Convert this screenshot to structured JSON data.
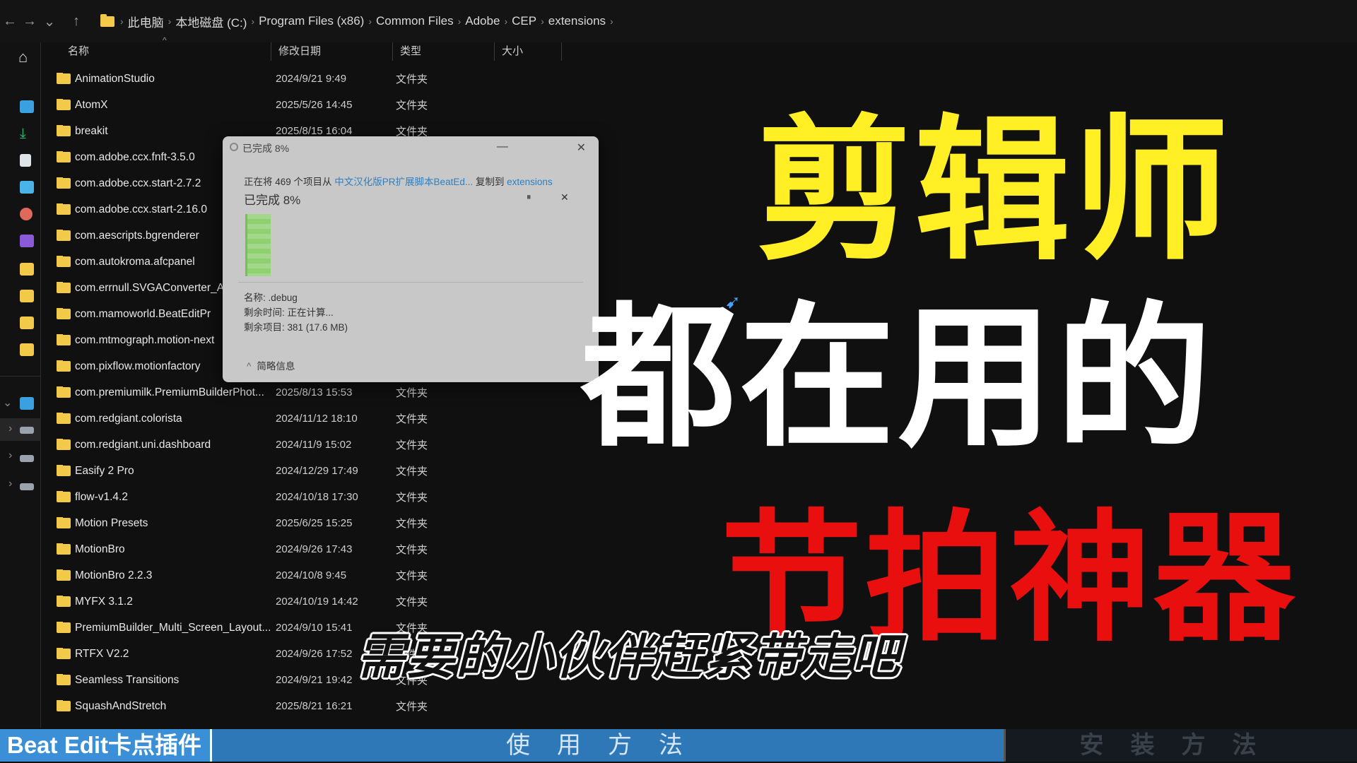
{
  "addressbar": {
    "back": "←",
    "forward": "→",
    "history": "⌄",
    "up": "↑",
    "crumbs": [
      "此电脑",
      "本地磁盘 (C:)",
      "Program Files (x86)",
      "Common Files",
      "Adobe",
      "CEP",
      "extensions"
    ]
  },
  "header": {
    "name": "名称",
    "modified": "修改日期",
    "type": "类型",
    "size": "大小"
  },
  "rows": [
    {
      "name": "AnimationStudio",
      "date": "2024/9/21 9:49",
      "type": "文件夹"
    },
    {
      "name": "AtomX",
      "date": "2025/5/26 14:45",
      "type": "文件夹"
    },
    {
      "name": "breakit",
      "date": "2025/8/15 16:04",
      "type": "文件夹"
    },
    {
      "name": "com.adobe.ccx.fnft-3.5.0",
      "date": "",
      "type": ""
    },
    {
      "name": "com.adobe.ccx.start-2.7.2",
      "date": "",
      "type": ""
    },
    {
      "name": "com.adobe.ccx.start-2.16.0",
      "date": "",
      "type": ""
    },
    {
      "name": "com.aescripts.bgrenderer",
      "date": "",
      "type": ""
    },
    {
      "name": "com.autokroma.afcpanel",
      "date": "",
      "type": ""
    },
    {
      "name": "com.errnull.SVGAConverter_AE",
      "date": "",
      "type": ""
    },
    {
      "name": "com.mamoworld.BeatEditPr",
      "date": "",
      "type": ""
    },
    {
      "name": "com.mtmograph.motion-next",
      "date": "",
      "type": ""
    },
    {
      "name": "com.pixflow.motionfactory",
      "date": "",
      "type": ""
    },
    {
      "name": "com.premiumilk.PremiumBuilderPhot...",
      "date": "2025/8/13 15:53",
      "type": "文件夹"
    },
    {
      "name": "com.redgiant.colorista",
      "date": "2024/11/12 18:10",
      "type": "文件夹"
    },
    {
      "name": "com.redgiant.uni.dashboard",
      "date": "2024/11/9 15:02",
      "type": "文件夹"
    },
    {
      "name": "Easify 2 Pro",
      "date": "2024/12/29 17:49",
      "type": "文件夹"
    },
    {
      "name": "flow-v1.4.2",
      "date": "2024/10/18 17:30",
      "type": "文件夹"
    },
    {
      "name": "Motion Presets",
      "date": "2025/6/25 15:25",
      "type": "文件夹"
    },
    {
      "name": "MotionBro",
      "date": "2024/9/26 17:43",
      "type": "文件夹"
    },
    {
      "name": "MotionBro 2.2.3",
      "date": "2024/10/8 9:45",
      "type": "文件夹"
    },
    {
      "name": "MYFX 3.1.2",
      "date": "2024/10/19 14:42",
      "type": "文件夹"
    },
    {
      "name": "PremiumBuilder_Multi_Screen_Layout...",
      "date": "2024/9/10 15:41",
      "type": "文件夹"
    },
    {
      "name": "RTFX V2.2",
      "date": "2024/9/26 17:52",
      "type": "文件夹"
    },
    {
      "name": "Seamless Transitions",
      "date": "2024/9/21 19:42",
      "type": "文件夹"
    },
    {
      "name": "SquashAndStretch",
      "date": "2025/8/21 16:21",
      "type": "文件夹"
    }
  ],
  "dialog": {
    "title": "已完成 8%",
    "minimize": "—",
    "close": "✕",
    "copy_prefix": "正在将 469 个项目从",
    "copy_source": "中文汉化版PR扩展脚本BeatEd...",
    "copy_mid": "复制到",
    "copy_dest": "extensions",
    "progress_label": "已完成 8%",
    "progress": 0.08,
    "pause": "⏸",
    "cancel": "✕",
    "file_name": "名称: .debug",
    "time_left": "剩余时间: 正在计算...",
    "items_left": "剩余项目: 381 (17.6 MB)",
    "details_toggle": "简略信息"
  },
  "overlay": {
    "line1": "剪辑师",
    "line2": "都在用的",
    "line3": "节拍神器",
    "subtitle": "需要的小伙伴赶紧带走吧",
    "colors": {
      "line1": "#ffef24",
      "line2": "#ffffff",
      "line3": "#ea0f0f"
    }
  },
  "banner": {
    "product": "Beat Edit卡点插件",
    "usage": "使用方法",
    "install": "安装方法"
  }
}
